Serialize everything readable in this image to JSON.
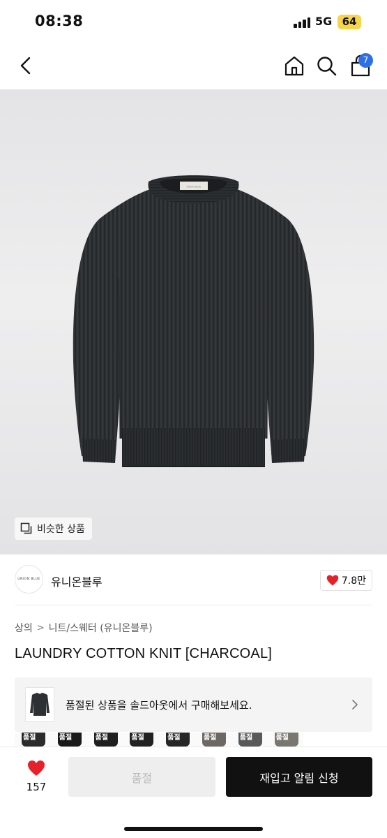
{
  "status_bar": {
    "time": "08:38",
    "network": "5G",
    "battery": "64"
  },
  "nav": {
    "cart_count": "7"
  },
  "hero": {
    "similar_label": "비슷한 상품",
    "garment_label": "UNION BLUE"
  },
  "brand": {
    "logo_text": "UNION BLUE",
    "name": "유니온블루",
    "likes": "7.8만"
  },
  "breadcrumb": {
    "level1": "상의",
    "separator": ">",
    "level2": "니트/스웨터 (유니온블루)"
  },
  "product": {
    "title": "LAUNDRY COTTON KNIT [CHARCOAL]"
  },
  "soldout_banner": {
    "text": "품절된 상품을 솔드아웃에서 구매해보세요."
  },
  "size_strip": [
    {
      "label": "품절",
      "color": "#2b2b2b"
    },
    {
      "label": "품절",
      "color": "#1a1a1a"
    },
    {
      "label": "품절",
      "color": "#1f1f1f"
    },
    {
      "label": "품절",
      "color": "#222222"
    },
    {
      "label": "품절",
      "color": "#262626"
    },
    {
      "label": "품절",
      "color": "#6d6861"
    },
    {
      "label": "품절",
      "color": "#595959"
    },
    {
      "label": "품절",
      "color": "#7a7670"
    }
  ],
  "bottom_bar": {
    "wish_count": "157",
    "soldout_label": "품절",
    "restock_label": "재입고 알림 신청"
  },
  "colors": {
    "accent_blue": "#2e6fe8",
    "heart_red": "#e8202a",
    "sweater": "#2e3133",
    "battery": "#f7d54a"
  }
}
